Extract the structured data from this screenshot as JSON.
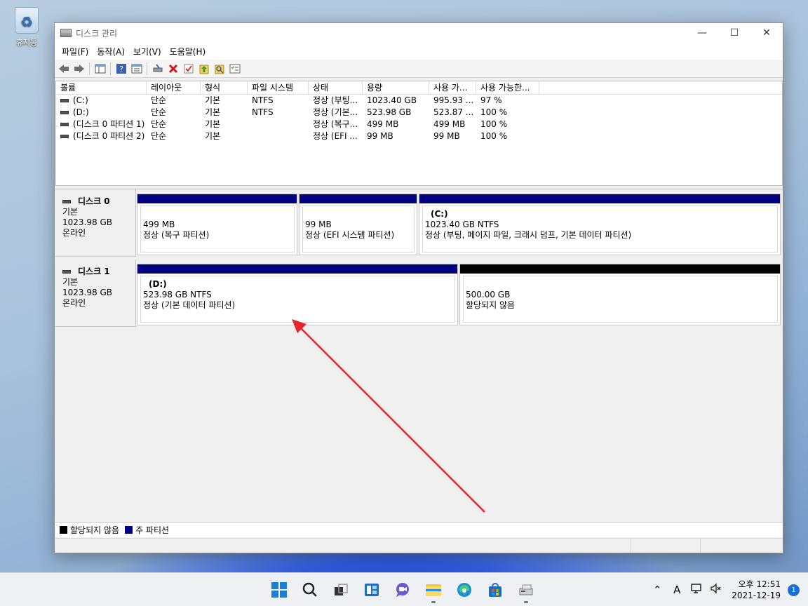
{
  "desktop": {
    "recycle_label": "휴지통"
  },
  "window": {
    "title": "디스크 관리",
    "controls": {
      "minimize": "—",
      "maximize": "☐",
      "close": "✕"
    }
  },
  "menu": [
    "파일(F)",
    "동작(A)",
    "보기(V)",
    "도움말(H)"
  ],
  "toolbar_icons": [
    "back-icon",
    "forward-icon",
    "console-tree-icon",
    "help-icon",
    "properties-icon",
    "connect-icon",
    "delete-icon",
    "check-icon",
    "up-icon",
    "search-icon",
    "list-icon"
  ],
  "volumes": {
    "headers": [
      "볼륨",
      "레이아웃",
      "형식",
      "파일 시스템",
      "상태",
      "용량",
      "사용 가...",
      "사용 가능한..."
    ],
    "rows": [
      [
        "(C:)",
        "단순",
        "기본",
        "NTFS",
        "정상 (부팅...",
        "1023.40 GB",
        "995.93 ...",
        "97 %"
      ],
      [
        "(D:)",
        "단순",
        "기본",
        "NTFS",
        "정상 (기본...",
        "523.98 GB",
        "523.87 ...",
        "100 %"
      ],
      [
        "(디스크 0 파티션 1)",
        "단순",
        "기본",
        "",
        "정상 (복구...",
        "499 MB",
        "499 MB",
        "100 %"
      ],
      [
        "(디스크 0 파티션 2)",
        "단순",
        "기본",
        "",
        "정상 (EFI ...",
        "99 MB",
        "99 MB",
        "100 %"
      ]
    ]
  },
  "disks": [
    {
      "name": "디스크 0",
      "type": "기본",
      "size": "1023.98 GB",
      "status": "온라인",
      "partitions": [
        {
          "label": "",
          "size": "499 MB",
          "status": "정상 (복구 파티션)",
          "kind": "primary"
        },
        {
          "label": "",
          "size": "99 MB",
          "status": "정상 (EFI 시스템 파티션)",
          "kind": "primary"
        },
        {
          "label": "(C:)",
          "size": "1023.40 GB NTFS",
          "status": "정상 (부팅, 페이지 파일, 크래시 덤프, 기본 데이터 파티션)",
          "kind": "primary"
        }
      ]
    },
    {
      "name": "디스크 1",
      "type": "기본",
      "size": "1023.98 GB",
      "status": "온라인",
      "partitions": [
        {
          "label": "(D:)",
          "size": "523.98 GB NTFS",
          "status": "정상 (기본 데이터 파티션)",
          "kind": "primary"
        },
        {
          "label": "",
          "size": "500.00 GB",
          "status": "할당되지 않음",
          "kind": "unallocated"
        }
      ]
    }
  ],
  "legend": {
    "unallocated": "할당되지 않음",
    "primary": "주 파티션"
  },
  "colors": {
    "primary": "#000080",
    "unallocated": "#000000",
    "arrow": "#e8252b"
  },
  "taskbar": {
    "apps": [
      "windows-start-icon",
      "search-icon",
      "task-view-icon",
      "widgets-icon",
      "chat-icon",
      "file-explorer-icon",
      "edge-icon",
      "store-icon",
      "disk-management-icon"
    ],
    "clock_period_time": "오후 12:51",
    "clock_date": "2021-12-19",
    "notification_count": "1",
    "ime": "A"
  }
}
